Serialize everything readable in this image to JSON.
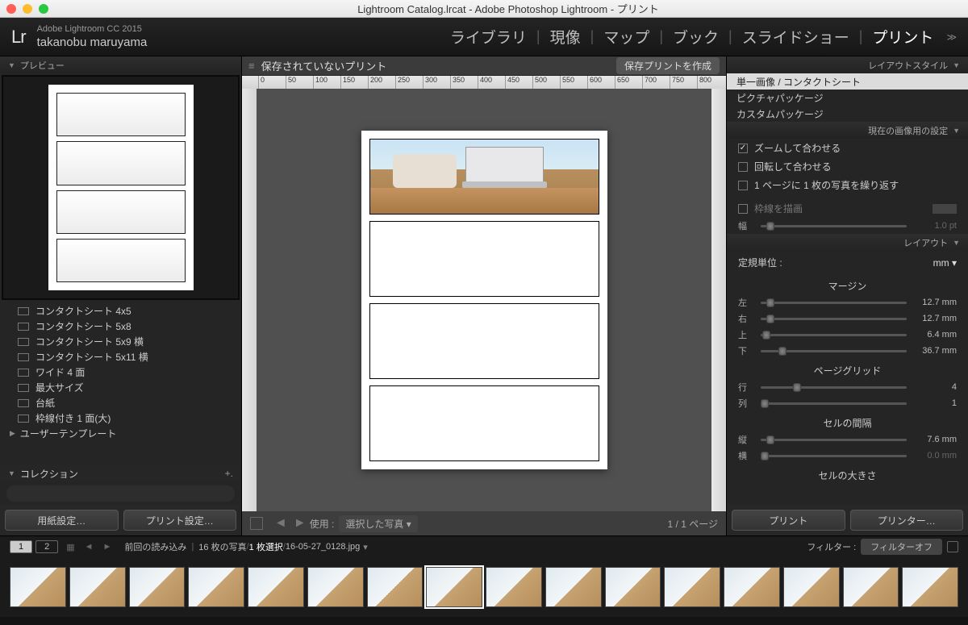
{
  "window": {
    "title": "Lightroom Catalog.lrcat - Adobe Photoshop Lightroom - プリント"
  },
  "header": {
    "logo": "Lr",
    "version": "Adobe Lightroom CC 2015",
    "user": "takanobu maruyama",
    "modules": [
      "ライブラリ",
      "現像",
      "マップ",
      "ブック",
      "スライドショー",
      "プリント"
    ],
    "active_module": "プリント"
  },
  "left": {
    "preview_title": "プレビュー",
    "templates": [
      "コンタクトシート 4x5",
      "コンタクトシート 5x8",
      "コンタクトシート 5x9 横",
      "コンタクトシート 5x11 横",
      "ワイド 4 面",
      "最大サイズ",
      "台紙",
      "枠線付き 1 面(大)"
    ],
    "user_templates": "ユーザーテンプレート",
    "collections": "コレクション",
    "page_setup": "用紙設定…",
    "print_settings": "プリント設定…"
  },
  "center": {
    "unsaved": "保存されていないプリント",
    "make_saved": "保存プリントを作成",
    "use_label": "使用 :",
    "use_value": "選択した写真",
    "page_of": "1 / 1 ページ",
    "ruler_ticks": [
      "0",
      "50",
      "100",
      "150",
      "200",
      "250",
      "300",
      "350",
      "400",
      "450",
      "500",
      "550",
      "600",
      "650",
      "700",
      "750",
      "800"
    ]
  },
  "right": {
    "layout_style": "レイアウトスタイル",
    "styles": [
      "単一画像 / コンタクトシート",
      "ピクチャパッケージ",
      "カスタムパッケージ"
    ],
    "current_settings": "現在の画像用の設定",
    "zoom_fit": "ズームして合わせる",
    "rotate_fit": "回転して合わせる",
    "repeat": "1 ページに 1 枚の写真を繰り返す",
    "draw_border": "枠線を描画",
    "border_width_label": "幅",
    "border_width_val": "1.0 pt",
    "layout_title": "レイアウト",
    "ruler_unit_label": "定規単位 :",
    "ruler_unit_val": "mm",
    "margin_title": "マージン",
    "margins": {
      "left": {
        "label": "左",
        "val": "12.7 mm"
      },
      "right": {
        "label": "右",
        "val": "12.7 mm"
      },
      "top": {
        "label": "上",
        "val": "6.4 mm"
      },
      "bottom": {
        "label": "下",
        "val": "36.7 mm"
      }
    },
    "page_grid": "ページグリッド",
    "rows": {
      "label": "行",
      "val": "4"
    },
    "cols": {
      "label": "列",
      "val": "1"
    },
    "cell_spacing": "セルの間隔",
    "v_spacing": {
      "label": "縦",
      "val": "7.6 mm"
    },
    "h_spacing": {
      "label": "横",
      "val": "0.0 mm"
    },
    "cell_size": "セルの大きさ",
    "print_btn": "プリント",
    "printer_btn": "プリンター…"
  },
  "film": {
    "pages": [
      "1",
      "2"
    ],
    "source": "前回の読み込み",
    "count": "16 枚の写真",
    "selected": "1 枚選択",
    "filename": "16-05-27_0128.jpg",
    "filter_label": "フィルター :",
    "filter_off": "フィルターオフ",
    "thumbs": 16,
    "selected_index": 7
  }
}
